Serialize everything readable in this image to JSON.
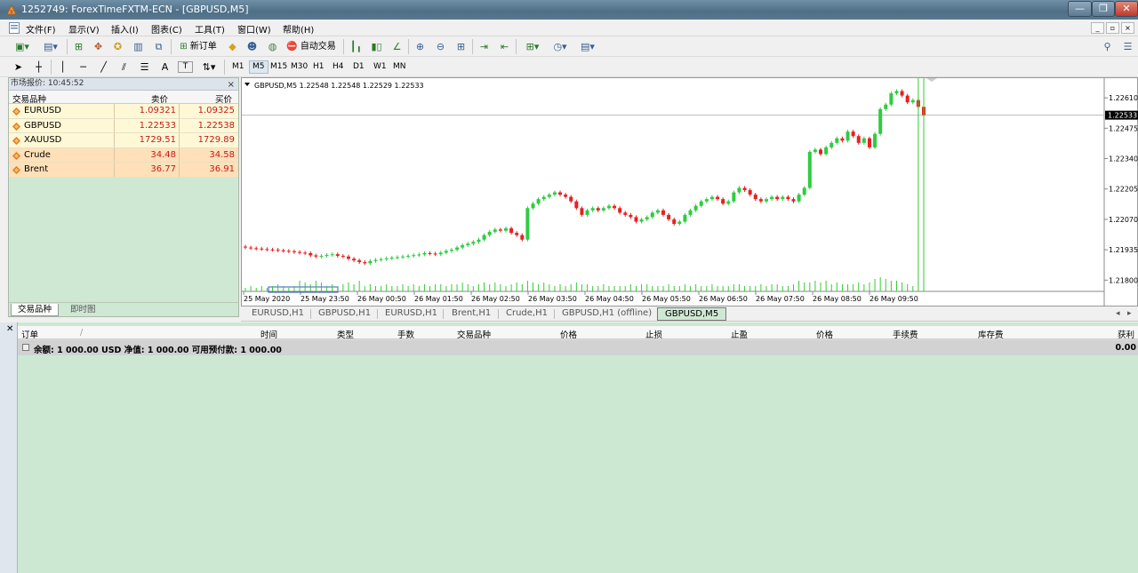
{
  "window": {
    "title": "1252749: ForexTimeFXTM-ECN - [GBPUSD,M5]",
    "min": "—",
    "max": "❐",
    "close": "✕"
  },
  "menu": [
    "文件(F)",
    "显示(V)",
    "插入(I)",
    "图表(C)",
    "工具(T)",
    "窗口(W)",
    "帮助(H)"
  ],
  "toolbar": {
    "new_order": "新订单",
    "auto_trade": "自动交易",
    "timeframes": [
      "M1",
      "M5",
      "M15",
      "M30",
      "H1",
      "H4",
      "D1",
      "W1",
      "MN"
    ],
    "active_tf": "M5",
    "text_tool": "A",
    "label_tool": "T"
  },
  "market_watch": {
    "header": "市场报价: 10:45:52",
    "close": "×",
    "cols": {
      "symbol": "交易品种",
      "bid": "卖价",
      "ask": "买价"
    },
    "rows": [
      {
        "symbol": "EURUSD",
        "bid": "1.09321",
        "ask": "1.09325"
      },
      {
        "symbol": "GBPUSD",
        "bid": "1.22533",
        "ask": "1.22538"
      },
      {
        "symbol": "XAUUSD",
        "bid": "1729.51",
        "ask": "1729.89"
      },
      {
        "symbol": "Crude",
        "bid": "34.48",
        "ask": "34.58"
      },
      {
        "symbol": "Brent",
        "bid": "36.77",
        "ask": "36.91"
      }
    ],
    "tabs": [
      "交易品种",
      "即时图"
    ]
  },
  "chart_tabs": [
    "EURUSD,H1",
    "GBPUSD,H1",
    "EURUSD,H1",
    "Brent,H1",
    "Crude,H1",
    "GBPUSD,H1 (offline)",
    "GBPUSD,M5"
  ],
  "chart_data": {
    "type": "candlestick",
    "title": "GBPUSD,M5  1.22548 1.22548 1.22529 1.22533",
    "current_price": "1.22533",
    "ylim": [
      1.2175,
      1.2265
    ],
    "y_ticks": [
      "1.22610",
      "1.22475",
      "1.22340",
      "1.22205",
      "1.22070",
      "1.21935",
      "1.21800"
    ],
    "y_tick_values": [
      1.2261,
      1.22475,
      1.2234,
      1.22205,
      1.2207,
      1.21935,
      1.218
    ],
    "x_ticks": [
      "25 May 2020",
      "25 May 23:50",
      "26 May 00:50",
      "26 May 01:50",
      "26 May 02:50",
      "26 May 03:50",
      "26 May 04:50",
      "26 May 05:50",
      "26 May 06:50",
      "26 May 07:50",
      "26 May 08:50",
      "26 May 09:50"
    ],
    "bull_color": "#2ecc40",
    "bear_color": "#e82020",
    "closes": [
      1.21945,
      1.21942,
      1.2194,
      1.21938,
      1.21936,
      1.21935,
      1.21932,
      1.2193,
      1.21928,
      1.21925,
      1.21922,
      1.2192,
      1.2191,
      1.21905,
      1.21908,
      1.21912,
      1.21915,
      1.21908,
      1.21905,
      1.21895,
      1.21888,
      1.2188,
      1.21875,
      1.21885,
      1.2189,
      1.21893,
      1.21897,
      1.219,
      1.21902,
      1.21905,
      1.21908,
      1.21911,
      1.21914,
      1.2192,
      1.21918,
      1.21915,
      1.21922,
      1.2193,
      1.21935,
      1.21945,
      1.21955,
      1.21962,
      1.2197,
      1.2198,
      1.22,
      1.22015,
      1.22025,
      1.2202,
      1.2203,
      1.2201,
      1.22,
      1.2198,
      1.2212,
      1.2214,
      1.2216,
      1.2217,
      1.2218,
      1.2219,
      1.2218,
      1.2217,
      1.2215,
      1.2212,
      1.2209,
      1.2211,
      1.2212,
      1.2211,
      1.2212,
      1.2213,
      1.2212,
      1.221,
      1.2209,
      1.2208,
      1.2206,
      1.2207,
      1.2208,
      1.221,
      1.2211,
      1.2209,
      1.2207,
      1.2205,
      1.2206,
      1.2209,
      1.2211,
      1.2213,
      1.2215,
      1.2216,
      1.2217,
      1.2216,
      1.2214,
      1.2215,
      1.2219,
      1.2221,
      1.222,
      1.2218,
      1.2216,
      1.2215,
      1.2216,
      1.2217,
      1.2216,
      1.2217,
      1.2216,
      1.2215,
      1.2218,
      1.2221,
      1.2237,
      1.2238,
      1.2236,
      1.2239,
      1.2241,
      1.2243,
      1.2242,
      1.2246,
      1.2244,
      1.2241,
      1.2243,
      1.2239,
      1.2245,
      1.2256,
      1.2258,
      1.2263,
      1.2264,
      1.2262,
      1.2259,
      1.226,
      1.2257,
      1.22533
    ],
    "volumes": [
      2,
      3,
      2,
      3,
      2,
      3,
      4,
      3,
      2,
      3,
      6,
      5,
      4,
      6,
      5,
      3,
      4,
      3,
      4,
      5,
      4,
      6,
      3,
      4,
      3,
      3,
      4,
      3,
      3,
      4,
      3,
      4,
      3,
      4,
      3,
      4,
      4,
      3,
      4,
      4,
      5,
      4,
      3,
      4,
      5,
      4,
      5,
      4,
      3,
      4,
      5,
      4,
      6,
      5,
      4,
      5,
      4,
      3,
      4,
      3,
      4,
      5,
      4,
      4,
      3,
      3,
      4,
      3,
      3,
      3,
      3,
      4,
      3,
      4,
      4,
      3,
      3,
      3,
      4,
      3,
      3,
      4,
      3,
      4,
      3,
      3,
      4,
      3,
      3,
      3,
      4,
      4,
      3,
      3,
      3,
      4,
      3,
      4,
      4,
      3,
      3,
      4,
      6,
      5,
      5,
      6,
      5,
      6,
      4,
      5,
      4,
      4,
      4,
      5,
      4,
      5,
      7,
      8,
      7,
      6,
      6,
      5,
      4,
      3
    ]
  },
  "terminal": {
    "close": "✕",
    "cols": [
      "订单",
      "/",
      "时间",
      "类型",
      "手数",
      "交易品种",
      "价格",
      "止损",
      "止盈",
      "价格",
      "手续费",
      "库存费",
      "获利"
    ],
    "balance": "余额: 1 000.00 USD  净值: 1 000.00  可用预付款: 1 000.00",
    "profit": "0.00"
  }
}
